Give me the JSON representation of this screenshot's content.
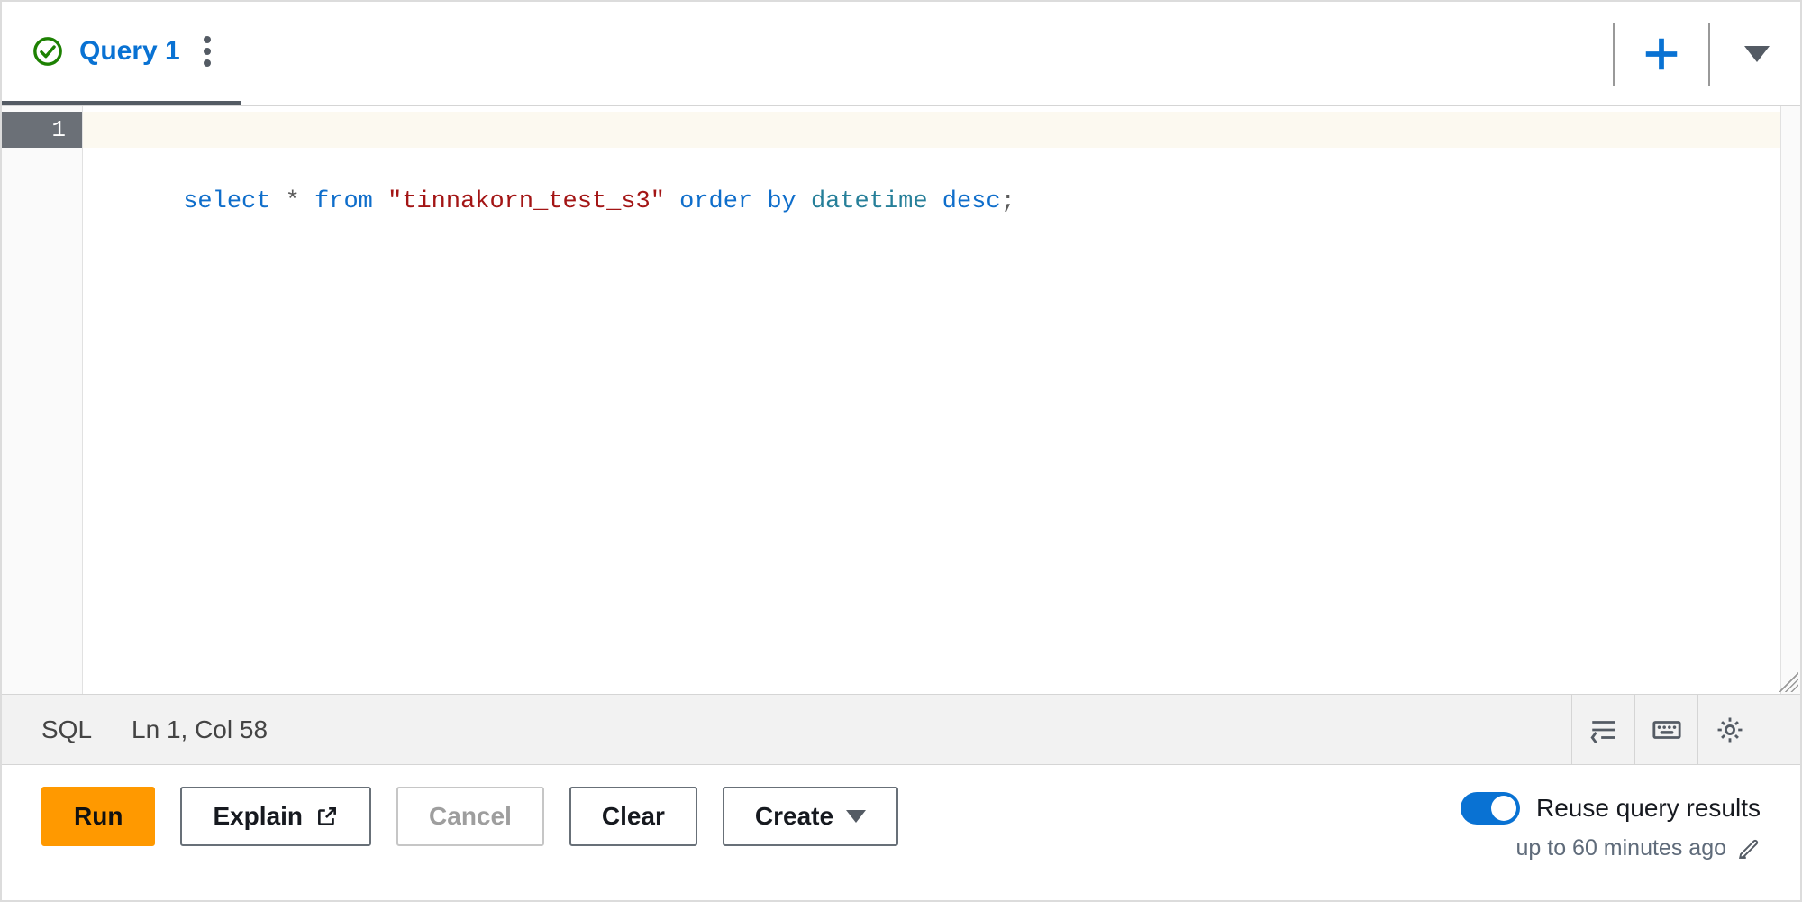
{
  "tab": {
    "label": "Query 1"
  },
  "editor": {
    "line_number": "1",
    "sql_tokens": {
      "t1": "select",
      "t2": "*",
      "t3": "from",
      "t4": "\"tinnakorn_test_s3\"",
      "t5": "order",
      "t6": "by",
      "t7": "datetime",
      "t8": "desc",
      "t9": ";"
    }
  },
  "status": {
    "language": "SQL",
    "position": "Ln 1, Col 58"
  },
  "actions": {
    "run": "Run",
    "explain": "Explain",
    "cancel": "Cancel",
    "clear": "Clear",
    "create": "Create"
  },
  "reuse": {
    "label": "Reuse query results",
    "sub": "up to 60 minutes ago"
  }
}
